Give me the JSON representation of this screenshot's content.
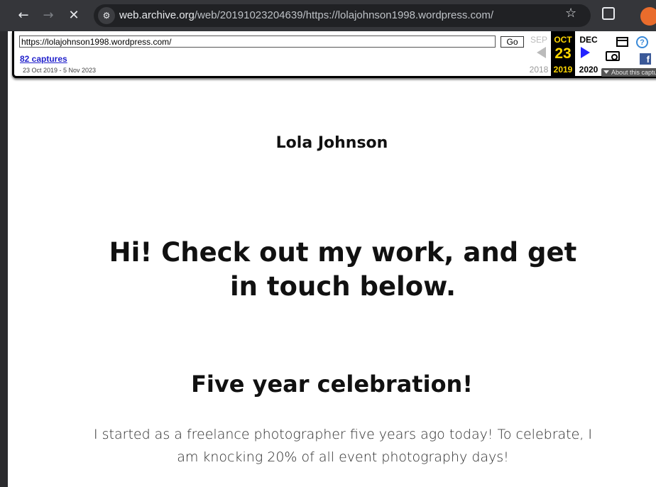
{
  "browser": {
    "url_host": "web.archive.org",
    "url_path": "/web/20191023204639/https://lolajohnson1998.wordpress.com/",
    "icons": [
      "back-icon",
      "forward-icon",
      "stop-icon",
      "site-info-icon",
      "star-icon",
      "extensions-icon",
      "profile-icon"
    ]
  },
  "wayback": {
    "url_value": "https://lolajohnson1998.wordpress.com/",
    "go_label": "Go",
    "captures_label": "82 captures",
    "date_range": "23 Oct 2019 - 5 Nov 2023",
    "prev_month": "SEP",
    "cur_month": "OCT",
    "next_month": "DEC",
    "cur_day": "23",
    "prev_year": "2018",
    "cur_year": "2019",
    "next_year": "2020",
    "about_label": "About this capture",
    "fb_letter": "f",
    "help_glyph": "?"
  },
  "page": {
    "site_title": "Lola Johnson",
    "hero_heading": "Hi! Check out my work, and get in touch below.",
    "section_heading": "Five year celebration!",
    "section_text": "I started as a freelance photographer five years ago today! To celebrate, I am knocking 20% of all event photography days!"
  },
  "colors": {
    "chrome_bg": "#35363a",
    "omnibox_bg": "#202124",
    "wayback_highlight": "#ffd700",
    "wayback_link": "#2222cc",
    "text_dark": "#111111"
  }
}
